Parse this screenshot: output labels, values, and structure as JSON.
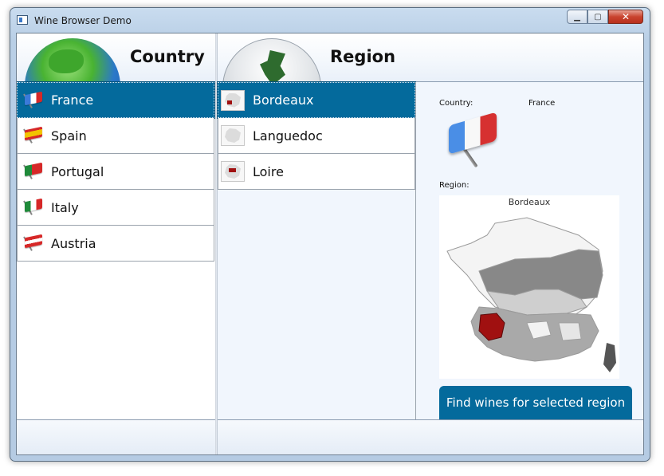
{
  "window": {
    "title": "Wine Browser Demo",
    "min_glyph": "▁",
    "max_glyph": "▢",
    "close_glyph": "✕"
  },
  "country_panel": {
    "header": "Country",
    "items": [
      {
        "label": "France",
        "flag": "flag-france-icon",
        "selected": true
      },
      {
        "label": "Spain",
        "flag": "flag-spain-icon",
        "selected": false
      },
      {
        "label": "Portugal",
        "flag": "flag-portugal-icon",
        "selected": false
      },
      {
        "label": "Italy",
        "flag": "flag-italy-icon",
        "selected": false
      },
      {
        "label": "Austria",
        "flag": "flag-austria-icon",
        "selected": false
      }
    ]
  },
  "region_panel": {
    "header": "Region",
    "items": [
      {
        "label": "Bordeaux",
        "selected": true
      },
      {
        "label": "Languedoc",
        "selected": false
      },
      {
        "label": "Loire",
        "selected": false
      }
    ]
  },
  "details": {
    "country_label": "Country:",
    "country_value": "France",
    "region_label": "Region:",
    "map_title": "Bordeaux",
    "find_button": "Find wines for selected region"
  },
  "colors": {
    "selection": "#046a9c",
    "highlight_region": "#a01010"
  }
}
